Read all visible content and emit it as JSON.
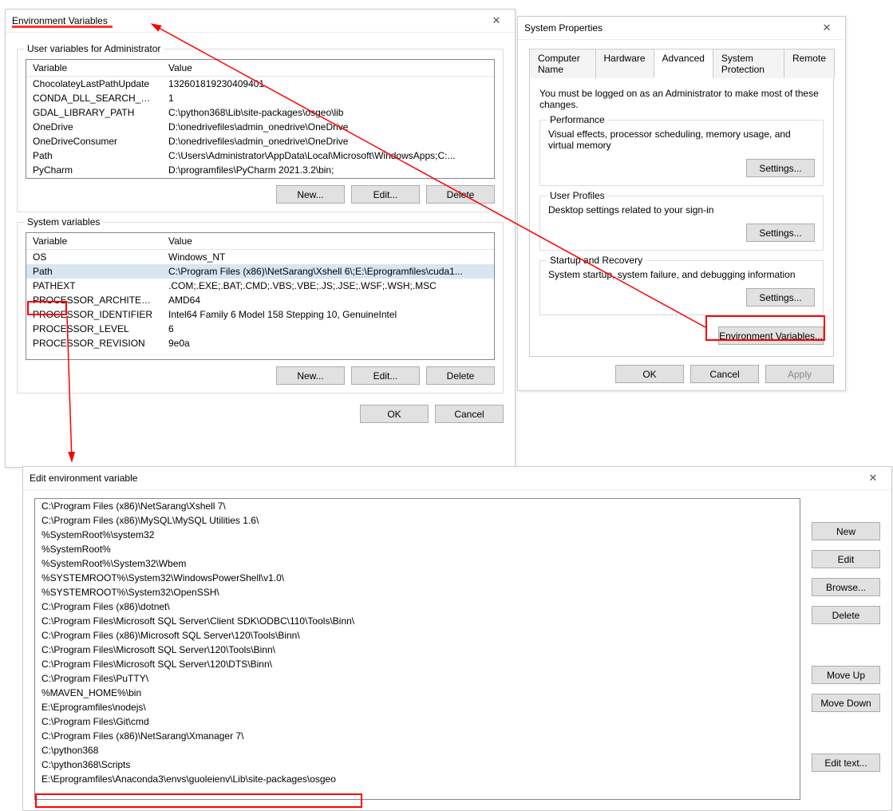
{
  "envvars_dialog": {
    "title": "Environment Variables",
    "user_group_label": "User variables for Administrator",
    "system_group_label": "System variables",
    "col_variable": "Variable",
    "col_value": "Value",
    "user_rows": [
      {
        "var": "ChocolateyLastPathUpdate",
        "val": "132601819230409401"
      },
      {
        "var": "CONDA_DLL_SEARCH_MOD...",
        "val": "1"
      },
      {
        "var": "GDAL_LIBRARY_PATH",
        "val": "C:\\python368\\Lib\\site-packages\\osgeo\\lib"
      },
      {
        "var": "OneDrive",
        "val": "D:\\onedrivefiles\\admin_onedrive\\OneDrive"
      },
      {
        "var": "OneDriveConsumer",
        "val": "D:\\onedrivefiles\\admin_onedrive\\OneDrive"
      },
      {
        "var": "Path",
        "val": "C:\\Users\\Administrator\\AppData\\Local\\Microsoft\\WindowsApps;C:..."
      },
      {
        "var": "PyCharm",
        "val": "D:\\programfiles\\PyCharm 2021.3.2\\bin;"
      }
    ],
    "system_rows": [
      {
        "var": "OS",
        "val": "Windows_NT"
      },
      {
        "var": "Path",
        "val": "C:\\Program Files (x86)\\NetSarang\\Xshell 6\\;E:\\Eprogramfiles\\cuda1...",
        "selected": true
      },
      {
        "var": "PATHEXT",
        "val": ".COM;.EXE;.BAT;.CMD;.VBS;.VBE;.JS;.JSE;.WSF;.WSH;.MSC"
      },
      {
        "var": "PROCESSOR_ARCHITECTURE",
        "val": "AMD64"
      },
      {
        "var": "PROCESSOR_IDENTIFIER",
        "val": "Intel64 Family 6 Model 158 Stepping 10, GenuineIntel"
      },
      {
        "var": "PROCESSOR_LEVEL",
        "val": "6"
      },
      {
        "var": "PROCESSOR_REVISION",
        "val": "9e0a"
      }
    ],
    "btn_new": "New...",
    "btn_edit": "Edit...",
    "btn_delete": "Delete",
    "btn_ok": "OK",
    "btn_cancel": "Cancel"
  },
  "sysprops": {
    "title": "System Properties",
    "tabs": [
      "Computer Name",
      "Hardware",
      "Advanced",
      "System Protection",
      "Remote"
    ],
    "intro": "You must be logged on as an Administrator to make most of these changes.",
    "perf_legend": "Performance",
    "perf_text": "Visual effects, processor scheduling, memory usage, and virtual memory",
    "prof_legend": "User Profiles",
    "prof_text": "Desktop settings related to your sign-in",
    "start_legend": "Startup and Recovery",
    "start_text": "System startup, system failure, and debugging information",
    "btn_settings": "Settings...",
    "btn_envvars": "Environment Variables...",
    "btn_ok": "OK",
    "btn_cancel": "Cancel",
    "btn_apply": "Apply"
  },
  "editpath": {
    "title": "Edit environment variable",
    "items": [
      "C:\\Program Files (x86)\\NetSarang\\Xshell 7\\",
      "C:\\Program Files (x86)\\MySQL\\MySQL Utilities 1.6\\",
      "%SystemRoot%\\system32",
      "%SystemRoot%",
      "%SystemRoot%\\System32\\Wbem",
      "%SYSTEMROOT%\\System32\\WindowsPowerShell\\v1.0\\",
      "%SYSTEMROOT%\\System32\\OpenSSH\\",
      "C:\\Program Files (x86)\\dotnet\\",
      "C:\\Program Files\\Microsoft SQL Server\\Client SDK\\ODBC\\110\\Tools\\Binn\\",
      "C:\\Program Files (x86)\\Microsoft SQL Server\\120\\Tools\\Binn\\",
      "C:\\Program Files\\Microsoft SQL Server\\120\\Tools\\Binn\\",
      "C:\\Program Files\\Microsoft SQL Server\\120\\DTS\\Binn\\",
      "C:\\Program Files\\PuTTY\\",
      "%MAVEN_HOME%\\bin",
      "E:\\Eprogramfiles\\nodejs\\",
      "C:\\Program Files\\Git\\cmd",
      "C:\\Program Files (x86)\\NetSarang\\Xmanager 7\\",
      "C:\\python368",
      "C:\\python368\\Scripts",
      "E:\\Eprogramfiles\\Anaconda3\\envs\\guoleienv\\Lib\\site-packages\\osgeo"
    ],
    "btn_new": "New",
    "btn_edit": "Edit",
    "btn_browse": "Browse...",
    "btn_delete": "Delete",
    "btn_moveup": "Move Up",
    "btn_movedown": "Move Down",
    "btn_edittext": "Edit text..."
  }
}
